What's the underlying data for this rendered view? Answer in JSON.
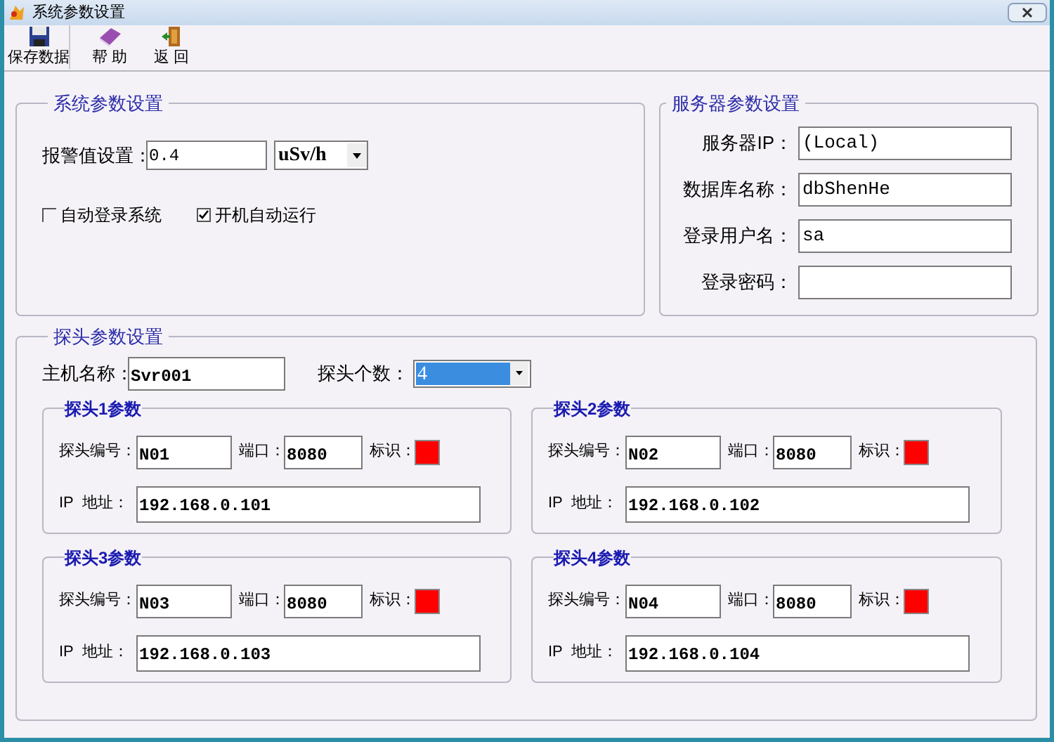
{
  "window": {
    "title": "系统参数设置"
  },
  "toolbar": [
    {
      "label": "保存数据",
      "kind": "save"
    },
    {
      "label": "帮 助",
      "kind": "help"
    },
    {
      "label": "返 回",
      "kind": "back"
    }
  ],
  "system_settings": {
    "title": "系统参数设置",
    "alarm_label": "报警值设置：",
    "alarm_value": "0.4",
    "unit": "uSv/h",
    "options": [
      {
        "label": "自动登录系统",
        "checked": false
      },
      {
        "label": "开机自动运行",
        "checked": true
      }
    ]
  },
  "server_settings": {
    "title": "服务器参数设置",
    "fields": [
      {
        "label": "服务器IP：",
        "value": "(Local)"
      },
      {
        "label": "数据库名称：",
        "value": "dbShenHe"
      },
      {
        "label": "登录用户名：",
        "value": "sa"
      },
      {
        "label": "登录密码："
      }
    ]
  },
  "probe_settings": {
    "title": "探头参数设置",
    "host_label": "主机名称：",
    "host_value": "Svr001",
    "count_label": "探头个数：",
    "count_value": "4",
    "probes": [
      {
        "title": "探头1参数",
        "id_label": "探头编号：",
        "id": "N01",
        "port_label": "端口：",
        "port": "8080",
        "mark_label": "标识：",
        "color": "#ff0000",
        "ip_label": "IP  地址：",
        "ip": "192.168.0.101"
      },
      {
        "title": "探头2参数",
        "id_label": "探头编号：",
        "id": "N02",
        "port_label": "端口：",
        "port": "8080",
        "mark_label": "标识：",
        "color": "#ff0000",
        "ip_label": "IP  地址：",
        "ip": "192.168.0.102"
      },
      {
        "title": "探头3参数",
        "id_label": "探头编号：",
        "id": "N03",
        "port_label": "端口：",
        "port": "8080",
        "mark_label": "标识：",
        "color": "#ff0000",
        "ip_label": "IP  地址：",
        "ip": "192.168.0.103"
      },
      {
        "title": "探头4参数",
        "id_label": "探头编号：",
        "id": "N04",
        "port_label": "端口：",
        "port": "8080",
        "mark_label": "标识：",
        "color": "#ff0000",
        "ip_label": "IP  地址：",
        "ip": "192.168.0.104"
      }
    ]
  }
}
